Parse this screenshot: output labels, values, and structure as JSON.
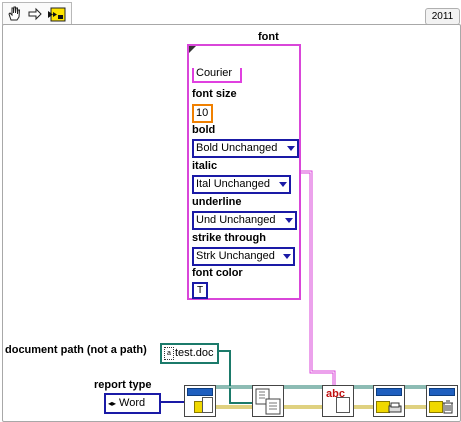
{
  "toolbar": {
    "tools": [
      {
        "icon": "hand-operate-icon"
      },
      {
        "icon": "arrow-right-icon"
      },
      {
        "icon": "run-vi-icon"
      }
    ]
  },
  "version_badge": "2011",
  "font_cluster": {
    "title": "font",
    "font_name_value": "Courier",
    "font_size_label": "font size",
    "font_size_value": "10",
    "bold_label": "bold",
    "bold_value": "Bold Unchanged",
    "italic_label": "italic",
    "italic_value": "Ital Unchanged",
    "underline_label": "underline",
    "underline_value": "Und Unchanged",
    "strike_label": "strike through",
    "strike_value": "Strk Unchanged",
    "color_label": "font color",
    "color_value": "T"
  },
  "document_path": {
    "label": "document path (not a path)",
    "value": "test.doc"
  },
  "report_type": {
    "label": "report type",
    "value": "Word"
  },
  "subvis": [
    {
      "icon": "new-report-icon"
    },
    {
      "icon": "open-document-icon"
    },
    {
      "icon": "set-font-icon",
      "text": "abc"
    },
    {
      "icon": "print-report-icon"
    },
    {
      "icon": "dispose-report-icon"
    }
  ],
  "colors": {
    "cluster_border": "#d946d9",
    "enum_border": "#1a1aa6",
    "numeric_border": "#f08000",
    "path_border": "#1b7a6a",
    "refnum_wire": "#1b7a6a",
    "error_wire": "#bfa300"
  }
}
